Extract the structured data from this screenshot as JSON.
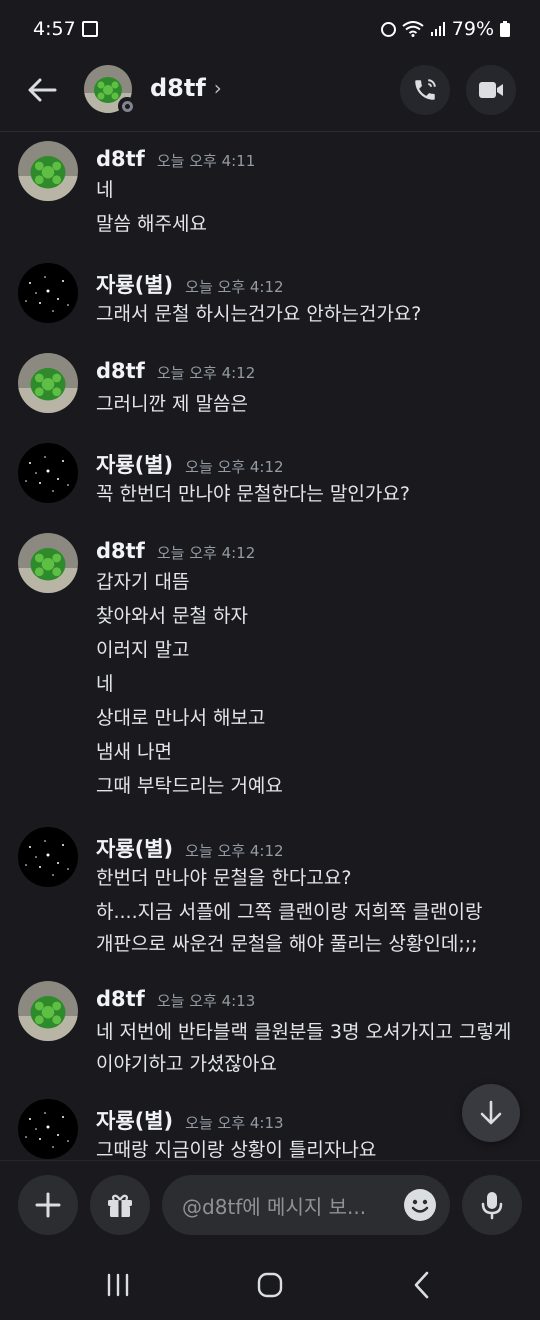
{
  "status": {
    "time": "4:57",
    "battery": "79%"
  },
  "header": {
    "title": "d8tf",
    "chevron": "›"
  },
  "messages": [
    {
      "author": "d8tf",
      "time": "오늘 오후 4:11",
      "avatar": "turtle",
      "lines": [
        "네",
        "말씀 해주세요"
      ]
    },
    {
      "author": "자룡(별)",
      "time": "오늘 오후 4:12",
      "avatar": "stars",
      "lines": [
        "그래서 문철 하시는건가요 안하는건가요?"
      ]
    },
    {
      "author": "d8tf",
      "time": "오늘 오후 4:12",
      "avatar": "turtle",
      "lines": [
        "그러니깐 제 말씀은"
      ]
    },
    {
      "author": "자룡(별)",
      "time": "오늘 오후 4:12",
      "avatar": "stars",
      "lines": [
        "꼭 한번더 만나야 문철한다는 말인가요?"
      ]
    },
    {
      "author": "d8tf",
      "time": "오늘 오후 4:12",
      "avatar": "turtle",
      "lines": [
        "갑자기 대뜸",
        "찾아와서 문철 하자",
        "이러지 말고",
        "네",
        "상대로 만나서 해보고",
        "냄새 나면",
        "그때 부탁드리는 거예요"
      ]
    },
    {
      "author": "자룡(별)",
      "time": "오늘 오후 4:12",
      "avatar": "stars",
      "lines": [
        "한번더 만나야 문철을 한다고요?",
        "하....지금 서플에 그쪽 클랜이랑 저희쪽 클랜이랑",
        "개판으로 싸운건 문철을 해야 풀리는 상황인데;;;"
      ]
    },
    {
      "author": "d8tf",
      "time": "오늘 오후 4:13",
      "avatar": "turtle",
      "lines": [
        "네 저번에 반타블랙 클원분들 3명 오셔가지고 그렇게",
        "이야기하고 가셨잖아요"
      ]
    },
    {
      "author": "자룡(별)",
      "time": "오늘 오후 4:13",
      "avatar": "stars",
      "lines": [
        "그때랑 지금이랑 상황이 틀리자나요"
      ]
    }
  ],
  "composer": {
    "placeholder": "@d8tf에 메시지 보..."
  }
}
